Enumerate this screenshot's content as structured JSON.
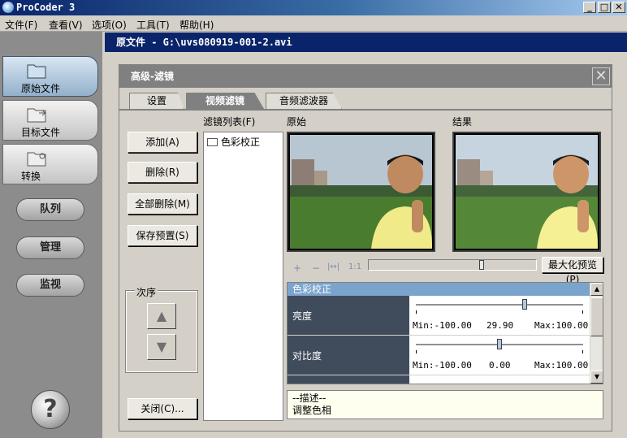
{
  "window": {
    "title": "ProCoder 3",
    "min": "_",
    "max": "□",
    "close": "✕"
  },
  "menu": [
    {
      "label": "文件(F)"
    },
    {
      "label": "查看(V)"
    },
    {
      "label": "选项(O)"
    },
    {
      "label": "工具(T)"
    },
    {
      "label": "帮助(H)"
    }
  ],
  "sidebar": {
    "tabs": [
      {
        "label": "原始文件"
      },
      {
        "label": "目标文件"
      },
      {
        "label": "转换"
      }
    ],
    "pills": [
      {
        "label": "队列"
      },
      {
        "label": "管理"
      },
      {
        "label": "监视"
      }
    ],
    "help": "?"
  },
  "file_bar": {
    "text": "原文件 - G:\\uvs080919-001-2.avi"
  },
  "dialog": {
    "title": "高级-滤镜",
    "close": "✕",
    "tabs": [
      {
        "label": "设置"
      },
      {
        "label": "视频滤镜"
      },
      {
        "label": "音频滤波器"
      }
    ],
    "buttons": {
      "add": "添加(A)",
      "delete": "删除(R)",
      "delete_all": "全部删除(M)",
      "save_preset": "保存预置(S)",
      "close": "关闭(C)..."
    },
    "filter_list": {
      "label": "滤镜列表(F)",
      "items": [
        "色彩校正"
      ]
    },
    "order": {
      "label": "次序",
      "up": "▲",
      "down": "▼"
    },
    "original_label": "原始",
    "result_label": "结果",
    "zoom": {
      "plus": "+",
      "minus": "−",
      "fit": "|↔|",
      "one": "1:1"
    },
    "max_preview": "最大化预览(P)",
    "preview_position": 0.68,
    "properties": {
      "header": "色彩校正",
      "rows": [
        {
          "name": "亮度",
          "min": "Min:-100.00",
          "value": "29.90",
          "max": "Max:100.00",
          "level": 0.649
        },
        {
          "name": "对比度",
          "min": "Min:-100.00",
          "value": "0.00",
          "max": "Max:100.00",
          "level": 0.5
        }
      ]
    },
    "description": {
      "title": "--描述--",
      "text": "调整色相"
    }
  }
}
